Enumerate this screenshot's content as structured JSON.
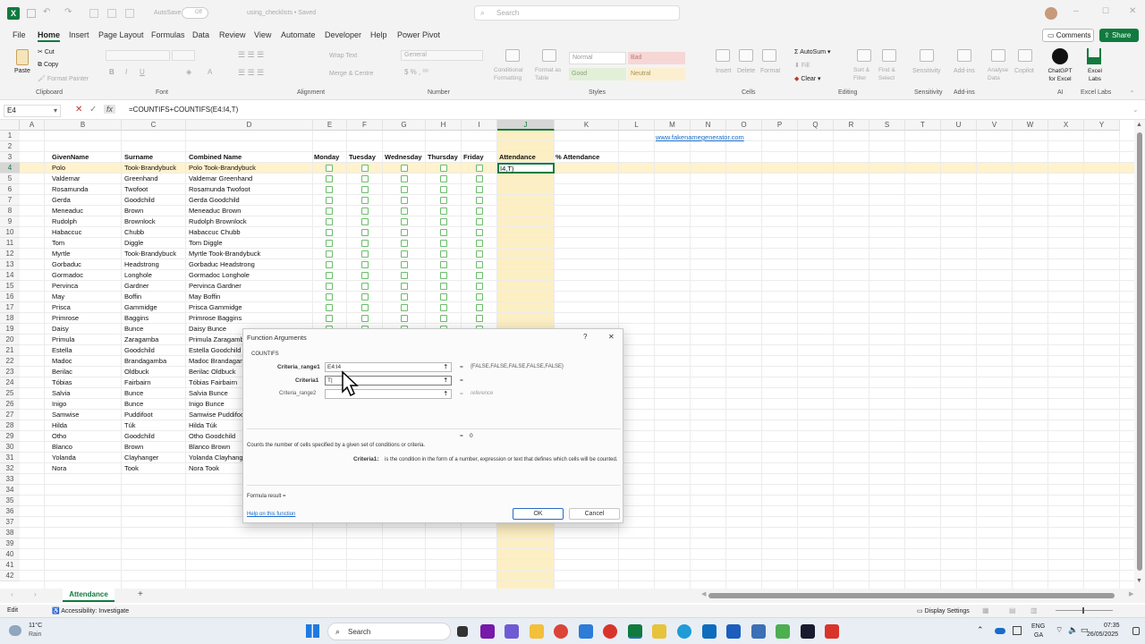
{
  "titlebar": {
    "autosave_label": "AutoSave",
    "autosave_state": "Off",
    "doc_title": "using_checklists • Saved",
    "search_placeholder": "Search",
    "excel_badge": "X"
  },
  "ribbon_tabs": [
    "File",
    "Home",
    "Insert",
    "Page Layout",
    "Formulas",
    "Data",
    "Review",
    "View",
    "Automate",
    "Developer",
    "Help",
    "Power Pivot"
  ],
  "ribbon_right": {
    "comments": "Comments",
    "share": "Share"
  },
  "ribbon": {
    "clipboard": {
      "paste": "Paste",
      "cut": "Cut",
      "copy": "Copy",
      "format_painter": "Format Painter",
      "group": "Clipboard"
    },
    "font_group": "Font",
    "alignment": {
      "wrap": "Wrap Text",
      "merge": "Merge & Centre",
      "group": "Alignment"
    },
    "number": {
      "format": "General",
      "group": "Number"
    },
    "styles": {
      "cf": "Conditional Formatting",
      "fat": "Format as Table",
      "normal": "Normal",
      "bad": "Bad",
      "good": "Good",
      "neutral": "Neutral",
      "group": "Styles"
    },
    "cells": {
      "insert": "Insert",
      "delete": "Delete",
      "format": "Format",
      "group": "Cells"
    },
    "editing": {
      "autosum": "AutoSum",
      "fill": "Fill",
      "clear": "Clear",
      "sort": "Sort & Filter",
      "find": "Find & Select",
      "group": "Editing"
    },
    "sensitivity": {
      "label": "Sensitivity",
      "group": "Sensitivity"
    },
    "addins": {
      "label": "Add-ins",
      "group": "Add-ins"
    },
    "analyse": "Analyse Data",
    "copilot": "Copilot",
    "chatgpt": {
      "label": "ChatGPT for Excel",
      "group": "AI"
    },
    "excellabs": {
      "label": "Excel Labs",
      "group": "Excel Labs"
    }
  },
  "formula_bar": {
    "name_box": "E4",
    "fx": "fx",
    "formula": "=COUNTIFS+COUNTIFS(E4:I4,T)"
  },
  "columns": [
    "A",
    "B",
    "C",
    "D",
    "E",
    "F",
    "G",
    "H",
    "I",
    "J",
    "K",
    "L",
    "M",
    "N",
    "O",
    "P",
    "Q",
    "R",
    "S",
    "T",
    "U",
    "V",
    "W",
    "X",
    "Y"
  ],
  "rows": [
    "1",
    "2",
    "3",
    "4",
    "5",
    "6",
    "7",
    "8",
    "9",
    "10",
    "11",
    "12",
    "13",
    "14",
    "15",
    "16",
    "17",
    "18",
    "19",
    "20",
    "21",
    "22",
    "23",
    "24",
    "25",
    "26",
    "27",
    "28",
    "29",
    "30",
    "31",
    "32",
    "33",
    "34",
    "35",
    "36",
    "37",
    "38",
    "39",
    "40",
    "41",
    "42"
  ],
  "link_cell": "www.fakenamegenerator.com",
  "headers": {
    "given": "GivenName",
    "surname": "Surname",
    "combined": "Combined Name",
    "mon": "Monday",
    "tue": "Tuesday",
    "wed": "Wednesday",
    "thu": "Thursday",
    "fri": "Friday",
    "att": "Attendance",
    "pct": "% Attendance"
  },
  "active_cell_text": "I4,T)",
  "people": [
    {
      "given": "Polo",
      "surname": "Took-Brandybuck",
      "combined": "Polo Took-Brandybuck"
    },
    {
      "given": "Valdemar",
      "surname": "Greenhand",
      "combined": "Valdemar Greenhand"
    },
    {
      "given": "Rosamunda",
      "surname": "Twofoot",
      "combined": "Rosamunda Twofoot"
    },
    {
      "given": "Gerda",
      "surname": "Goodchild",
      "combined": "Gerda Goodchild"
    },
    {
      "given": "Meneaduc",
      "surname": "Brown",
      "combined": "Meneaduc Brown"
    },
    {
      "given": "Rudolph",
      "surname": "Brownlock",
      "combined": "Rudolph Brownlock"
    },
    {
      "given": "Habaccuc",
      "surname": "Chubb",
      "combined": "Habaccuc Chubb"
    },
    {
      "given": "Tom",
      "surname": "Diggle",
      "combined": "Tom Diggle"
    },
    {
      "given": "Myrtle",
      "surname": "Took-Brandybuck",
      "combined": "Myrtle Took-Brandybuck"
    },
    {
      "given": "Gorbaduc",
      "surname": "Headstrong",
      "combined": "Gorbaduc Headstrong"
    },
    {
      "given": "Gormadoc",
      "surname": "Longhole",
      "combined": "Gormadoc Longhole"
    },
    {
      "given": "Pervinca",
      "surname": "Gardner",
      "combined": "Pervinca Gardner"
    },
    {
      "given": "May",
      "surname": "Boffin",
      "combined": "May Boffin"
    },
    {
      "given": "Prisca",
      "surname": "Gammidge",
      "combined": "Prisca Gammidge"
    },
    {
      "given": "Primrose",
      "surname": "Baggins",
      "combined": "Primrose Baggins"
    },
    {
      "given": "Daisy",
      "surname": "Bunce",
      "combined": "Daisy Bunce"
    },
    {
      "given": "Primula",
      "surname": "Zaragamba",
      "combined": "Primula Zaragamba"
    },
    {
      "given": "Estella",
      "surname": "Goodchild",
      "combined": "Estella Goodchild"
    },
    {
      "given": "Madoc",
      "surname": "Brandagamba",
      "combined": "Madoc Brandagamba"
    },
    {
      "given": "Berilac",
      "surname": "Oldbuck",
      "combined": "Berilac Oldbuck"
    },
    {
      "given": "Tóbias",
      "surname": "Fairbairn",
      "combined": "Tóbias Fairbairn"
    },
    {
      "given": "Salvia",
      "surname": "Bunce",
      "combined": "Salvia Bunce"
    },
    {
      "given": "Inigo",
      "surname": "Bunce",
      "combined": "Inigo Bunce"
    },
    {
      "given": "Samwise",
      "surname": "Puddifoot",
      "combined": "Samwise Puddifoot"
    },
    {
      "given": "Hilda",
      "surname": "Túk",
      "combined": "Hilda Túk"
    },
    {
      "given": "Otho",
      "surname": "Goodchild",
      "combined": "Otho Goodchild"
    },
    {
      "given": "Blanco",
      "surname": "Brown",
      "combined": "Blanco Brown"
    },
    {
      "given": "Yolanda",
      "surname": "Clayhanger",
      "combined": "Yolanda Clayhanger"
    },
    {
      "given": "Nora",
      "surname": "Took",
      "combined": "Nora Took"
    }
  ],
  "dialog": {
    "title": "Function Arguments",
    "help_glyph": "?",
    "close_glyph": "✕",
    "function_name": "COUNTIFS",
    "label1": "Criteria_range1",
    "value1": "E4:I4",
    "result1": "{FALSE,FALSE,FALSE,FALSE,FALSE}",
    "label2": "Criteria1",
    "value2": "T|",
    "result2": "",
    "label3": "Criteria_range2",
    "value3": "",
    "result3": "reference",
    "equals": "=",
    "total": "0",
    "description": "Counts the number of cells specified by a given set of conditions or criteria.",
    "arg_name": "Criteria1:",
    "arg_desc": "is the condition in the form of a number, expression or text that defines which cells will be counted.",
    "formula_result": "Formula result =",
    "help_link": "Help on this function",
    "ok": "OK",
    "cancel": "Cancel"
  },
  "sheet_tab": "Attendance",
  "add_sheet": "+",
  "status": {
    "mode": "Edit",
    "accessibility": "Accessibility: Investigate",
    "display_settings": "Display Settings"
  },
  "taskbar": {
    "temp": "11°C",
    "weather": "Rain",
    "search": "Search",
    "lang1": "ENG",
    "lang2": "GA",
    "time": "07:35",
    "date": "26/05/2025"
  },
  "colors": {
    "excel_green": "#117a3e",
    "highlight": "#fff2cc",
    "attendance_col": "#fdefc4",
    "checkbox": "#6bbd6b",
    "link": "#1a6cc9"
  }
}
